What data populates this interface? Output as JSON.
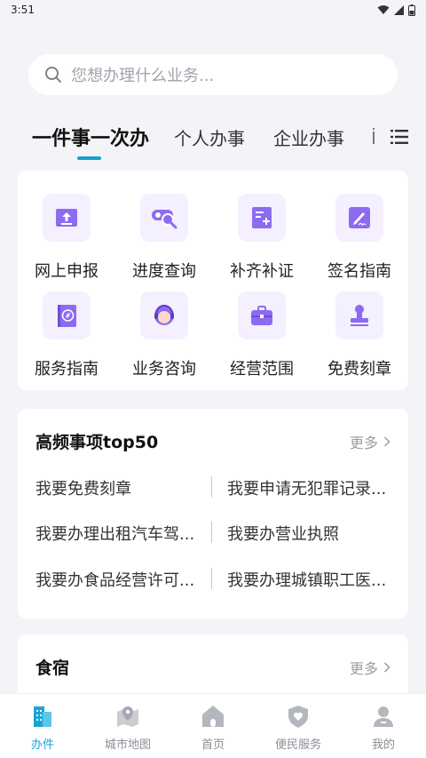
{
  "status_bar": {
    "time": "3:51"
  },
  "search": {
    "placeholder": "您想办理什么业务..."
  },
  "tabs": [
    {
      "label": "一件事一次办",
      "active": true
    },
    {
      "label": "个人办事"
    },
    {
      "label": "企业办事"
    }
  ],
  "services": [
    {
      "label": "网上申报",
      "icon": "upload-icon"
    },
    {
      "label": "进度查询",
      "icon": "progress-search-icon"
    },
    {
      "label": "补齐补证",
      "icon": "document-add-icon"
    },
    {
      "label": "签名指南",
      "icon": "signature-icon"
    },
    {
      "label": "服务指南",
      "icon": "compass-book-icon"
    },
    {
      "label": "业务咨询",
      "icon": "customer-service-icon"
    },
    {
      "label": "经营范围",
      "icon": "briefcase-icon"
    },
    {
      "label": "免费刻章",
      "icon": "stamp-icon"
    }
  ],
  "top_items": {
    "title": "高频事项top50",
    "more": "更多",
    "items": [
      "我要免费刻章",
      "我要申请无犯罪记录...",
      "我要办理出租汽车驾...",
      "我要办营业执照",
      "我要办食品经营许可...",
      "我要办理城镇职工医..."
    ]
  },
  "food": {
    "title": "食宿",
    "more": "更多"
  },
  "bottom_nav": [
    {
      "label": "办件",
      "icon": "building-icon",
      "active": true
    },
    {
      "label": "城市地图",
      "icon": "map-pin-icon"
    },
    {
      "label": "首页",
      "icon": "home-icon"
    },
    {
      "label": "便民服务",
      "icon": "shield-heart-icon"
    },
    {
      "label": "我的",
      "icon": "user-icon"
    }
  ],
  "colors": {
    "accent": "#1aa3d4",
    "icon_purple": "#8d6bf0",
    "icon_bg": "#f4f0ff"
  }
}
